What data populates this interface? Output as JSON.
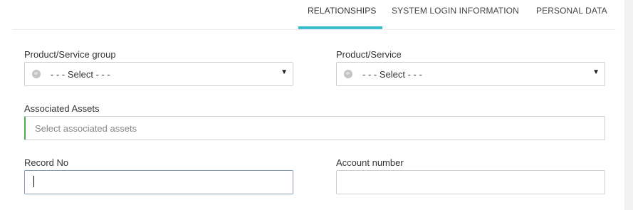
{
  "tabs": [
    {
      "label": "RELATIONSHIPS",
      "active": true
    },
    {
      "label": "SYSTEM LOGIN INFORMATION",
      "active": false
    },
    {
      "label": "PERSONAL DATA",
      "active": false
    }
  ],
  "form": {
    "product_service_group": {
      "label": "Product/Service group",
      "value": "- - - Select - - -",
      "icon": "globe-icon"
    },
    "product_service": {
      "label": "Product/Service",
      "value": "- - - Select - - -",
      "icon": "globe-icon"
    },
    "associated_assets": {
      "label": "Associated Assets",
      "placeholder": "Select associated assets"
    },
    "record_no": {
      "label": "Record No",
      "value": ""
    },
    "account_number": {
      "label": "Account number",
      "value": ""
    }
  },
  "colors": {
    "accent": "#3bbfcf",
    "assets_border": "#4cae4c"
  }
}
